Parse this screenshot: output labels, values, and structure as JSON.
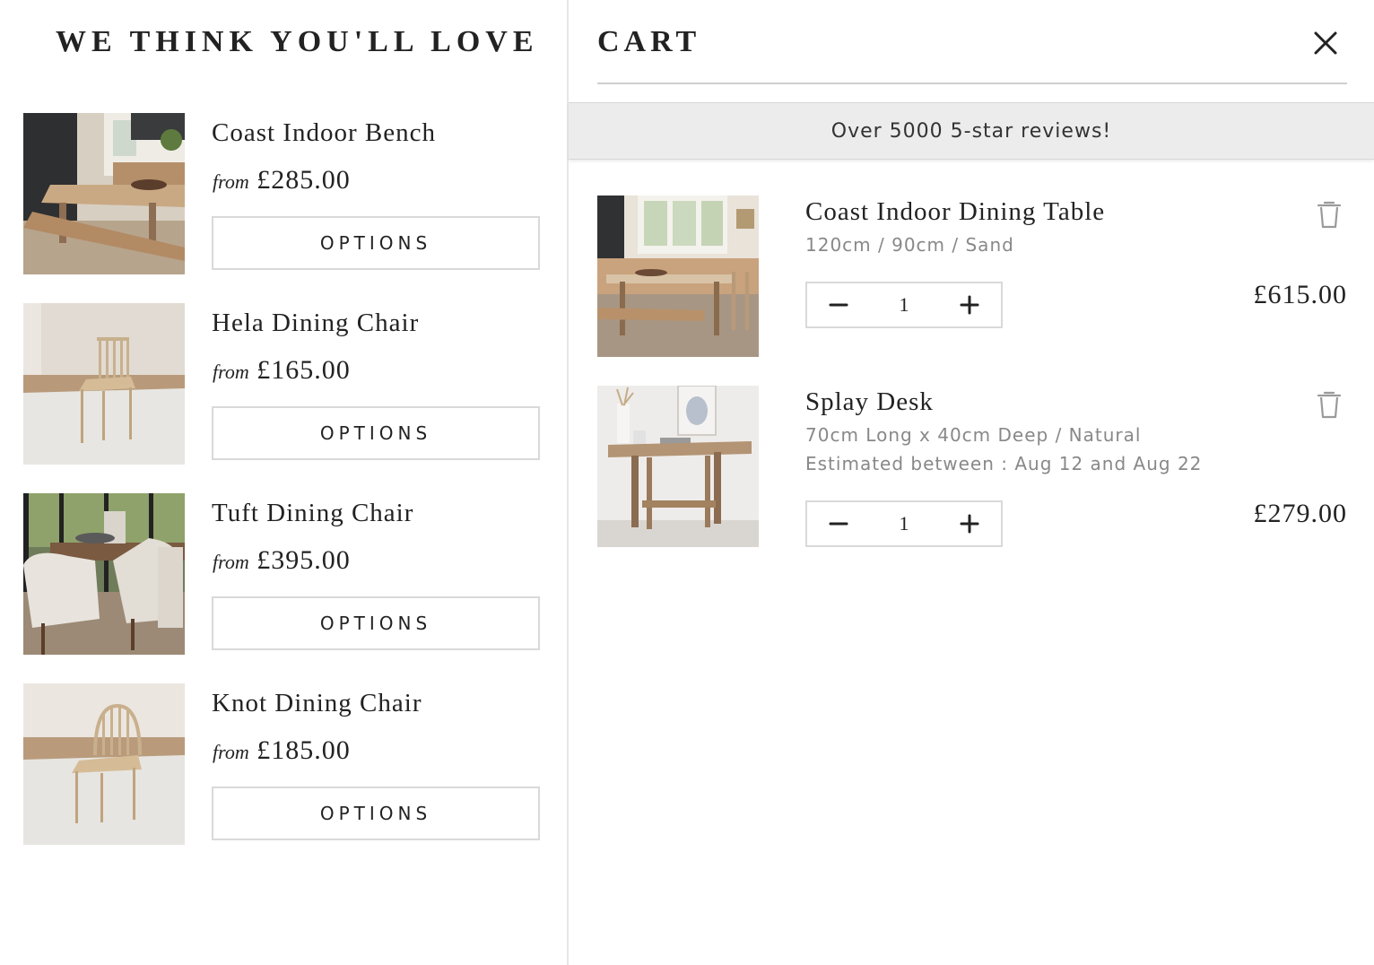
{
  "recommendations": {
    "title": "WE THINK YOU'LL LOVE",
    "items": [
      {
        "name": "Coast Indoor Bench",
        "from_label": "from",
        "price": "£285.00",
        "button": "OPTIONS",
        "image": "bench-photo"
      },
      {
        "name": "Hela Dining Chair",
        "from_label": "from",
        "price": "£165.00",
        "button": "OPTIONS",
        "image": "spindle-chair-photo"
      },
      {
        "name": "Tuft Dining Chair",
        "from_label": "from",
        "price": "£395.00",
        "button": "OPTIONS",
        "image": "upholstered-chairs-photo"
      },
      {
        "name": "Knot Dining Chair",
        "from_label": "from",
        "price": "£185.00",
        "button": "OPTIONS",
        "image": "windsor-chair-photo"
      }
    ]
  },
  "cart": {
    "title": "CART",
    "close_icon": "close-icon",
    "banner": "Over 5000 5-star reviews!",
    "items": [
      {
        "name": "Coast Indoor Dining Table",
        "variant": "120cm / 90cm / Sand",
        "eta": "",
        "quantity": "1",
        "price": "£615.00",
        "image": "dining-table-photo"
      },
      {
        "name": "Splay Desk",
        "variant": "70cm Long x 40cm Deep / Natural",
        "eta": "Estimated between : Aug 12 and Aug 22",
        "quantity": "1",
        "price": "£279.00",
        "image": "desk-photo"
      }
    ]
  },
  "icons": {
    "trash": "trash-icon",
    "minus": "minus-icon",
    "plus": "plus-icon"
  },
  "colors": {
    "border": "#d9d9d9",
    "banner_bg": "#ececec",
    "text": "#222222",
    "muted_text": "#888888"
  }
}
